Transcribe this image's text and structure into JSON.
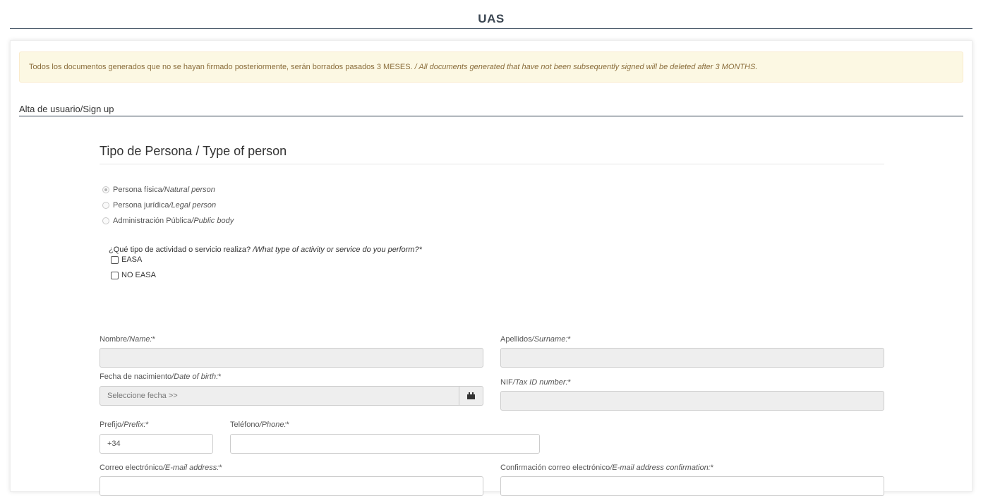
{
  "header": {
    "title": "UAS"
  },
  "alert": {
    "text_es": "Todos los documentos generados que no se hayan firmado posteriormente, serán borrados pasados 3 MESES.",
    "text_en": "/ All documents generated that have not been subsequently signed will be deleted after 3 MONTHS."
  },
  "section": {
    "title": "Alta de usuario/Sign up"
  },
  "person_type": {
    "legend": "Tipo de Persona / Type of person",
    "options": [
      {
        "es": "Persona física",
        "en": "/Natural person",
        "selected": true
      },
      {
        "es": "Persona jurídica",
        "en": "/Legal person",
        "selected": false
      },
      {
        "es": "Administración Pública",
        "en": "/Public body",
        "selected": false
      }
    ]
  },
  "activity": {
    "question_es": "¿Qué tipo de actividad o servicio realiza? ",
    "question_en": "/What type of activity or service do you perform?*",
    "options": [
      "EASA",
      "NO EASA"
    ]
  },
  "fields": {
    "name": {
      "label_es": "Nombre",
      "label_en": "/Name:",
      "req": "*",
      "value": ""
    },
    "surname": {
      "label_es": "Apellidos",
      "label_en": "/Surname:",
      "req": "*",
      "value": ""
    },
    "dob": {
      "label_es": "Fecha de nacimiento",
      "label_en": "/Date of birth:",
      "req": "*",
      "placeholder": "Seleccione fecha >>"
    },
    "nif": {
      "label_es": "NIF",
      "label_en": "/Tax ID number:",
      "req": "*",
      "value": ""
    },
    "prefix": {
      "label_es": "Prefijo",
      "label_en": "/Prefix:",
      "req": "*",
      "value": "+34"
    },
    "phone": {
      "label_es": "Teléfono",
      "label_en": "/Phone:",
      "req": "*",
      "value": ""
    },
    "email": {
      "label_es": "Correo electrónico",
      "label_en": "/E-mail address:",
      "req": "*",
      "value": ""
    },
    "email_confirm": {
      "label_es": "Confirmación correo electrónico",
      "label_en": "/E-mail address confirmation:",
      "req": "*",
      "value": ""
    }
  }
}
